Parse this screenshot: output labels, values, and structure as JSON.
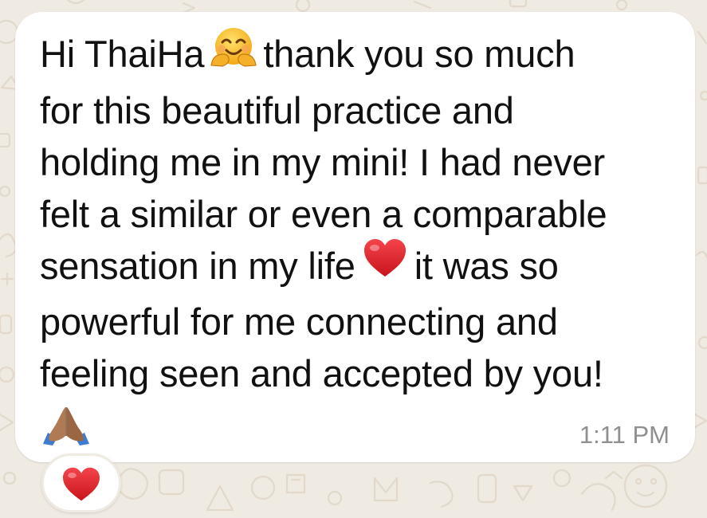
{
  "message": {
    "line1_a": "Hi ThaiHa",
    "line1_b": "thank you so much",
    "line2": "for this beautiful practice and",
    "line3": "holding me in my mini! I had never",
    "line4": "felt a similar or even a comparable",
    "line5_a": "sensation in my life",
    "line5_b": "it was so",
    "line6": "powerful for me connecting and",
    "line7": "feeling seen and accepted by you!",
    "emojis": [
      "hugging-face-icon",
      "red-heart-icon",
      "folded-hands-icon"
    ],
    "timestamp": "1:11 PM"
  },
  "reaction": {
    "emoji": "red-heart-icon"
  },
  "colors": {
    "bubble": "#ffffff",
    "background": "#efeae2",
    "text": "#111111",
    "timestamp": "#8f8f8f",
    "heart": "#e0242f"
  }
}
